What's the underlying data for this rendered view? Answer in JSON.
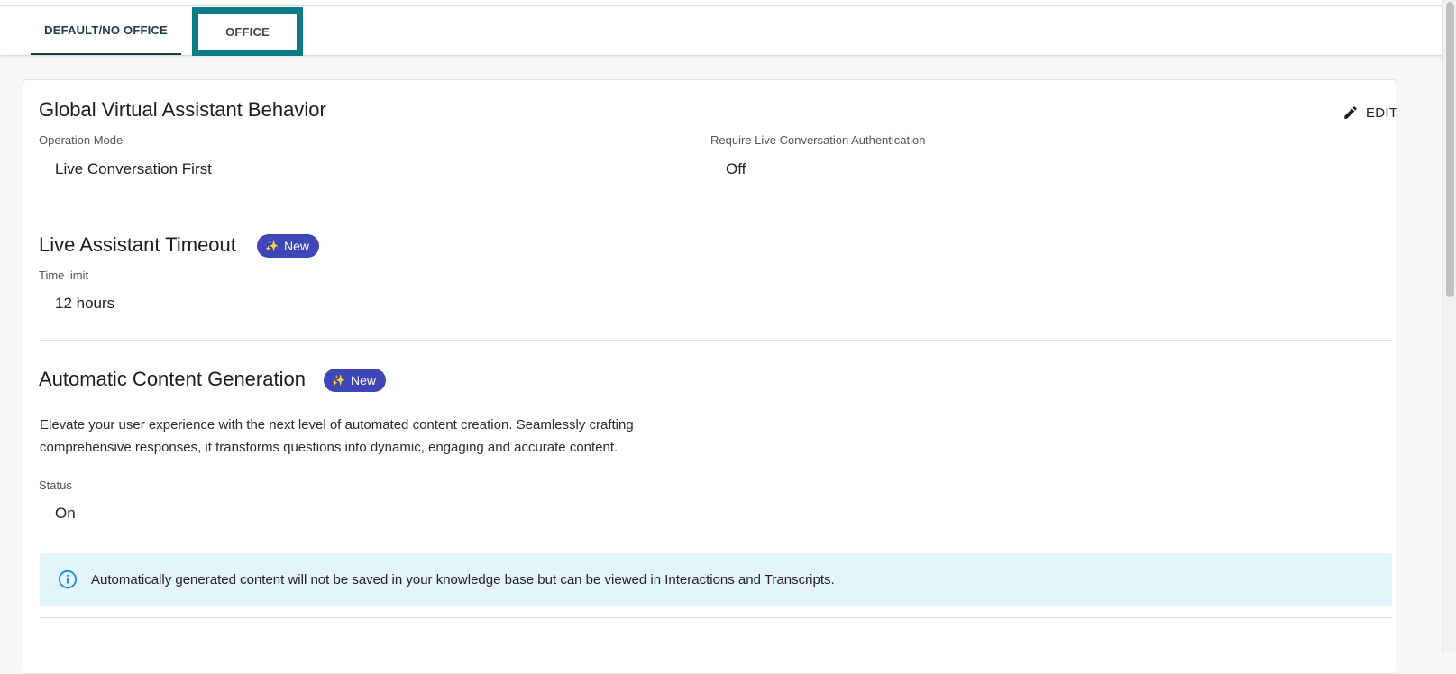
{
  "tabs": [
    {
      "label": "DEFAULT/NO OFFICE",
      "active": true
    },
    {
      "label": "OFFICE",
      "active": false
    }
  ],
  "global_behavior": {
    "title": "Global Virtual Assistant Behavior",
    "edit_label": "EDIT",
    "operation_mode_label": "Operation Mode",
    "operation_mode_value": "Live Conversation First",
    "auth_label": "Require Live Conversation Authentication",
    "auth_value": "Off"
  },
  "timeout": {
    "title": "Live Assistant Timeout",
    "badge": "New",
    "time_limit_label": "Time limit",
    "time_limit_value": "12 hours"
  },
  "content_generation": {
    "title": "Automatic Content Generation",
    "badge": "New",
    "description": "Elevate your user experience with the next level of automated content creation. Seamlessly crafting comprehensive responses, it transforms questions into dynamic, engaging and accurate content.",
    "status_label": "Status",
    "status_value": "On",
    "info_text": "Automatically generated content will not be saved in your knowledge base but can be viewed in Interactions and Transcripts."
  },
  "icons": {
    "edit": "pencil-icon",
    "badge": "sparkle-icon",
    "info": "info-icon"
  },
  "colors": {
    "accent_tab_highlight": "#0e7c86",
    "badge_bg": "#3f47b8",
    "info_bg": "#e4f4fb",
    "info_icon": "#1a8fd8",
    "active_tab_text": "#1f3a4d"
  }
}
